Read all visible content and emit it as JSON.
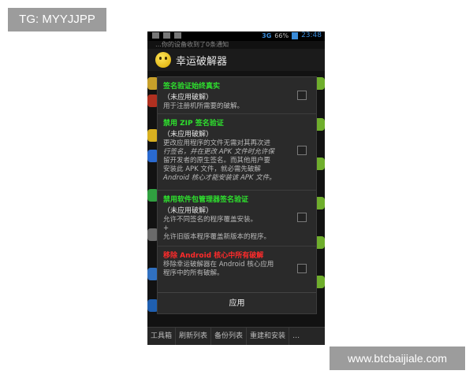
{
  "watermarks": {
    "top_left": "TG: MYYJJPP",
    "bottom_right": "www.btcbaijiale.com"
  },
  "statusbar": {
    "network": "3G",
    "battery": "66%",
    "time": "23:48"
  },
  "notification": "…你的设备收到了0条通知",
  "app": {
    "title": "幸运破解器",
    "icon": "smiley-icon"
  },
  "dialog": {
    "options": [
      {
        "title": "签名验证始终真实",
        "status": "（未应用破解）",
        "desc": [
          "用于注册机所需要的破解。"
        ],
        "checked": false,
        "title_color": "#2ee02e"
      },
      {
        "title": "禁用 ZIP 签名验证",
        "status": "（未应用破解）",
        "desc": [
          "更改应用程序的文件无需对其再次进",
          "行签名，并在更改 APK 文件时允许保",
          "留开发者的原生签名。而其他用户要",
          "安装此 APK 文件，就必需先破解",
          "Android 核心才能安装该 APK 文件。"
        ],
        "checked": false,
        "title_color": "#2ee02e"
      },
      {
        "title": "禁用软件包管理器签名验证",
        "status": "（未应用破解）",
        "desc": [
          "允许不同签名的程序覆盖安装。",
          "+",
          "允许旧版本程序覆盖新版本的程序。"
        ],
        "checked": false,
        "title_color": "#2ee02e"
      },
      {
        "title": "移除 Android 核心中所有破解",
        "desc": [
          "移除幸运破解器在 Android 核心应用",
          "程序中的所有破解。"
        ],
        "checked": false,
        "title_color": "#ff2b2b"
      }
    ],
    "apply_label": "应用"
  },
  "tabs": [
    "工具箱",
    "刷新列表",
    "备份列表",
    "重建和安装",
    "…"
  ]
}
